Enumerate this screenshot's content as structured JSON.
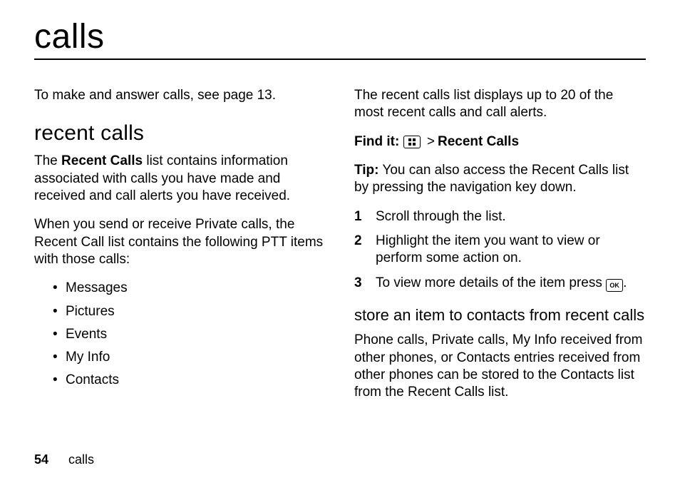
{
  "title": "calls",
  "footer": {
    "page_number": "54",
    "section": "calls"
  },
  "left": {
    "intro": "To make and answer calls, see page 13.",
    "h2": "recent calls",
    "para1_pre": "The ",
    "para1_bold": "Recent Calls",
    "para1_post": " list contains information associated with calls you have made and received and call alerts you have received.",
    "para2": "When you send or receive Private calls, the Recent Call list contains the following PTT items with those calls:",
    "bullets": [
      "Messages",
      "Pictures",
      "Events",
      "My Info",
      "Contacts"
    ]
  },
  "right": {
    "para1": "The recent calls list displays up to 20 of the most recent calls and call alerts.",
    "findit_label": "Find it:",
    "findit_menu_icon": "menu-icon",
    "findit_sep": ">",
    "findit_target": "Recent Calls",
    "tip_label": "Tip:",
    "tip_body": " You can also access the Recent Calls list by pressing the navigation key down.",
    "steps": [
      {
        "n": "1",
        "text": "Scroll through the list."
      },
      {
        "n": "2",
        "text": "Highlight the item you want to view or perform some action on."
      },
      {
        "n": "3",
        "pre": "To view more details of the item press ",
        "key_icon": "ok-key-icon",
        "key_label": "OK",
        "post": "."
      }
    ],
    "h3": "store an item to contacts from recent calls",
    "para_store": "Phone calls, Private calls, My Info received from other phones, or Contacts entries received from other phones can be stored to the Contacts list from the Recent Calls list."
  }
}
